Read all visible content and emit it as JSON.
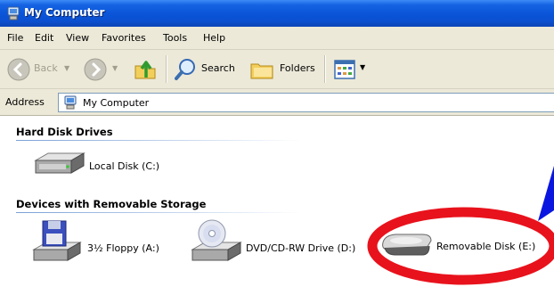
{
  "window": {
    "title": "My Computer"
  },
  "menu": [
    "File",
    "Edit",
    "View",
    "Favorites",
    "Tools",
    "Help"
  ],
  "toolbar": {
    "back": "Back",
    "search": "Search",
    "folders": "Folders"
  },
  "address": {
    "label": "Address",
    "value": "My Computer"
  },
  "groups": [
    {
      "header": "Hard Disk Drives",
      "items": [
        "Local Disk (C:)"
      ]
    },
    {
      "header": "Devices with Removable Storage",
      "items": [
        "3½ Floppy (A:)",
        "DVD/CD-RW Drive (D:)",
        "Removable Disk (E:)"
      ]
    }
  ],
  "colors": {
    "titlebar": "#0a55d9",
    "chrome": "#ece9d8",
    "annotation_ellipse": "#e8121c",
    "annotation_arrow": "#0a16e0"
  },
  "icons": [
    "my-computer-icon",
    "back-arrow-icon",
    "forward-arrow-icon",
    "up-folder-icon",
    "search-icon",
    "folders-icon",
    "views-icon",
    "hard-drive-icon",
    "floppy-drive-icon",
    "dvd-drive-icon",
    "removable-disk-icon"
  ]
}
